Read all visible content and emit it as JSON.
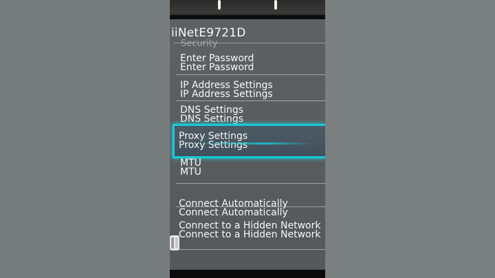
{
  "network": {
    "name": "iiNetE9721D"
  },
  "ghost_text": {
    "security": "Security",
    "hidden_tail": "Network"
  },
  "settings": {
    "enter_password": "Enter Password",
    "ip_settings": "IP Address Settings",
    "dns_settings": "DNS Settings",
    "proxy_settings": "Proxy Settings",
    "mtu": "MTU",
    "connect_auto": "Connect Automatically",
    "connect_hidden": "Connect to a Hidden Network"
  },
  "focused_item": "Proxy Settings",
  "colors": {
    "focus": "#19c9d6",
    "screen": "#5e6163",
    "background": "#767b7d"
  },
  "icons": {
    "controller": "joycon-icon"
  }
}
